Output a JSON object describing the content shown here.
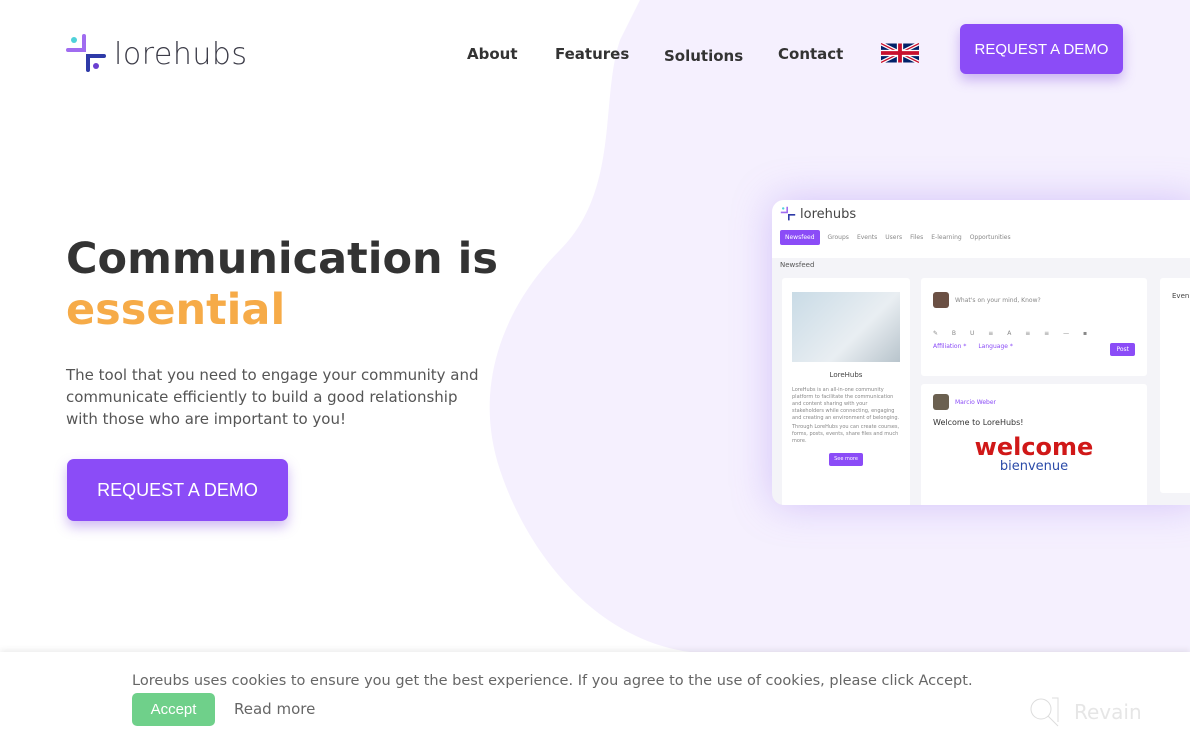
{
  "brand": {
    "name": "lorehubs"
  },
  "nav": {
    "items": [
      "About",
      "Features",
      "Solutions",
      "Contact"
    ],
    "language_icon": "uk-flag-icon",
    "cta": "REQUEST A DEMO"
  },
  "hero": {
    "title_line1": "Communication is",
    "title_line2": "essential",
    "subtitle": "The tool that you need to engage your community and communicate efficiently to build a good relationship with those who are important to you!",
    "cta": "REQUEST A DEMO"
  },
  "mockup": {
    "brand": "lorehubs",
    "tabs": [
      "Newsfeed",
      "Groups",
      "Events",
      "Users",
      "Files",
      "E-learning",
      "Opportunities"
    ],
    "section": "Newsfeed",
    "profile_title": "LoreHubs",
    "profile_text": "LoreHubs is an all-in-one community platform to facilitate the communication and content sharing with your stakeholders while connecting, engaging and creating an environment of belonging.",
    "profile_text2": "Through LoreHubs you can create courses, forms, posts, events, share files and much more.",
    "see_more": "See more",
    "composer_placeholder": "What's on your mind, Know?",
    "affiliation": "Affiliation *",
    "language": "Language *",
    "post": "Post",
    "author": "Marcio Weber",
    "post_title": "Welcome to LoreHubs!",
    "wordcloud_main": "welcome",
    "wordcloud_sub": "bienvenue",
    "events_label": "Even"
  },
  "cookie": {
    "text": "Loreubs uses cookies to ensure you get the best experience. If you agree to the use of cookies, please click Accept.",
    "accept": "Accept",
    "read_more": "Read more"
  },
  "watermark": "Revain",
  "colors": {
    "accent": "#8b4cf7",
    "highlight": "#f6ab48",
    "accept": "#6fd08a",
    "blob": "#f5f0fe"
  }
}
